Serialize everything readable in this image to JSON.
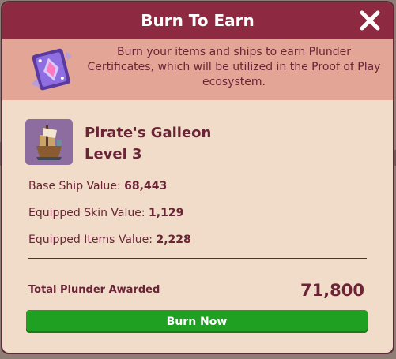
{
  "modal": {
    "title": "Burn To Earn",
    "description": "Burn your items and ships to earn Plunder Certificates, which will be utilized in the Proof of Play ecosystem.",
    "close_icon": "close-icon"
  },
  "ship": {
    "name": "Pirate's Galleon",
    "level": "Level 3",
    "icon": "galleon-ship-icon"
  },
  "stats": [
    {
      "label": "Base Ship Value:",
      "value": "68,443"
    },
    {
      "label": "Equipped Skin Value:",
      "value": "1,129"
    },
    {
      "label": "Equipped Items Value:",
      "value": "2,228"
    }
  ],
  "total": {
    "label": "Total Plunder Awarded",
    "value": "71,800"
  },
  "button": {
    "label": "Burn Now"
  },
  "colors": {
    "header": "#8d2940",
    "banner": "#e3a596",
    "panel": "#f0dcc8",
    "text": "#6a2436",
    "button": "#1fa022"
  }
}
